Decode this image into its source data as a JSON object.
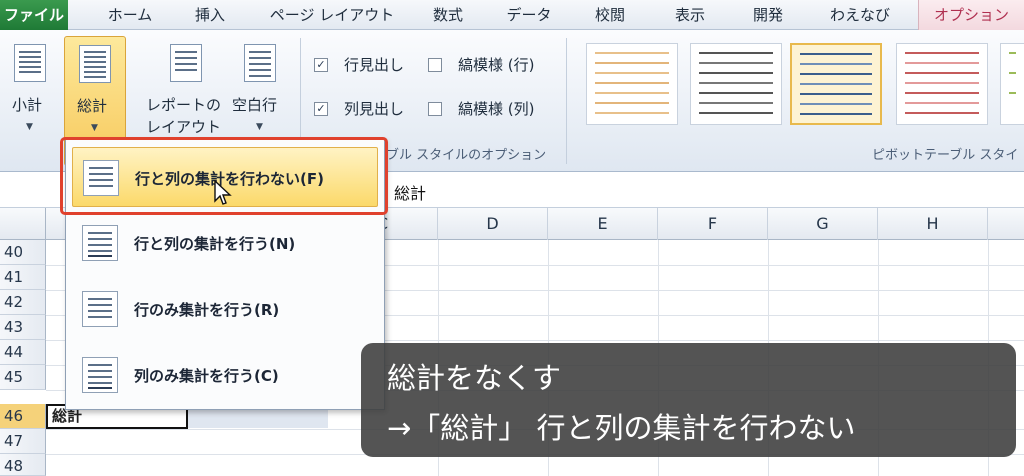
{
  "tabs": {
    "file": "ファイル",
    "home": "ホーム",
    "insert": "挿入",
    "page_layout": "ページ レイアウト",
    "formulas": "数式",
    "data": "データ",
    "review": "校閲",
    "view": "表示",
    "developer": "開発",
    "wae": "わえなび",
    "options": "オプション"
  },
  "ribbon": {
    "subtotal_label": "小計",
    "grand_total_label": "総計",
    "report_layout_label_1": "レポートの",
    "report_layout_label_2": "レイアウト",
    "blank_rows_label": "空白行",
    "row_headers_label": "行見出し",
    "column_headers_label": "列見出し",
    "banded_rows_label": "縞模様 (行)",
    "banded_columns_label": "縞模様 (列)",
    "row_headers_checked": "✓",
    "column_headers_checked": "✓",
    "style_options_group_label": "ブル スタイルのオプション",
    "pivot_styles_group_label": "ピボットテーブル スタイ"
  },
  "formula_bar": {
    "value": "総計"
  },
  "grid": {
    "columns": [
      "C",
      "D",
      "E",
      "F",
      "G",
      "H"
    ],
    "rows": [
      "40",
      "41",
      "42",
      "43",
      "44",
      "45",
      "46",
      "47",
      "48"
    ],
    "cell_a46": "総計"
  },
  "menu": {
    "items": [
      {
        "label": "行と列の集計を行わない(F)"
      },
      {
        "label": "行と列の集計を行う(N)"
      },
      {
        "label": "行のみ集計を行う(R)"
      },
      {
        "label": "列のみ集計を行う(C)"
      }
    ]
  },
  "caption": {
    "line1": "総計をなくす",
    "line2": "→「総計」 行と列の集計を行わない"
  },
  "colors": {
    "highlight_border": "#e0412d",
    "menu_hover": "#fbd96a",
    "file_tab": "#1f7a36"
  }
}
